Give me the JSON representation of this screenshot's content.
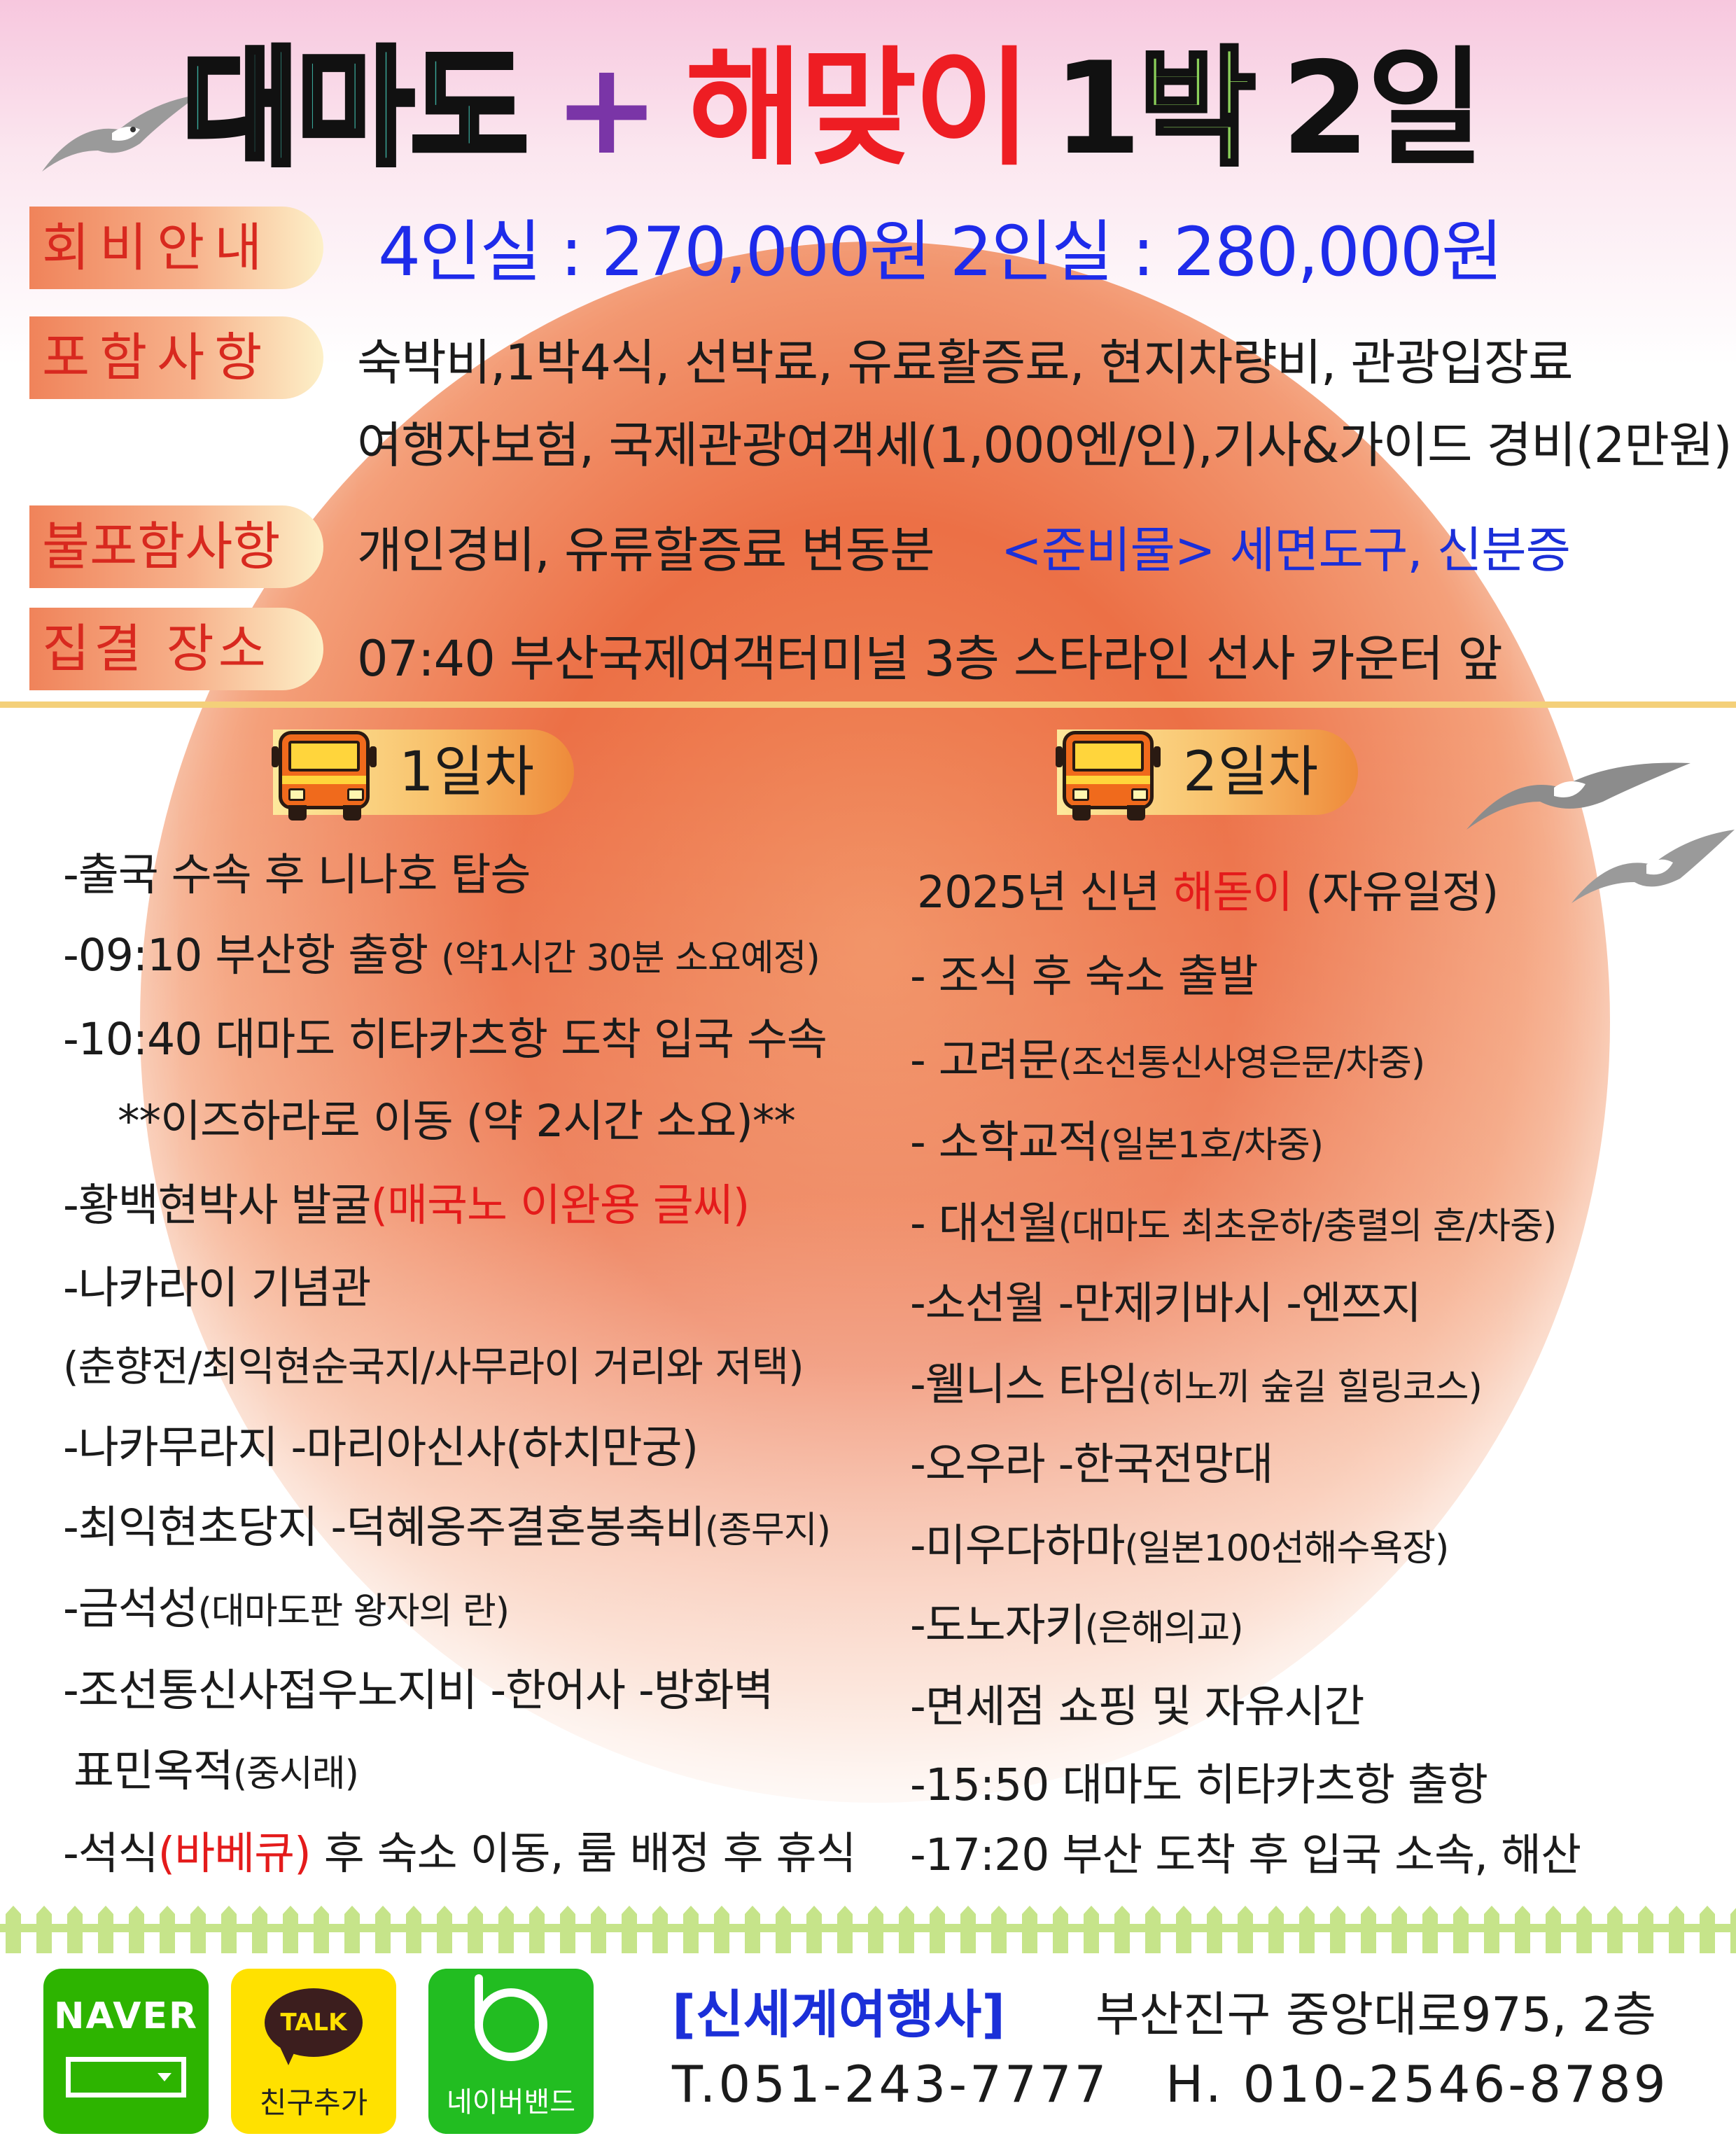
{
  "title": {
    "part1": "대마도",
    "plus": "+",
    "part2": "해맞이",
    "num1": "1",
    "bak": "박",
    "num2": "2일"
  },
  "info": {
    "fee_label": "회비안내",
    "fee_text": "4인실 : 270,000원   2인실 : 280,000원",
    "include_label": "포함사항",
    "include_line1": "숙박비,1박4식, 선박료, 유료활증료, 현지차량비, 관광입장료",
    "include_line2": "여행자보험, 국제관광여객세(1,000엔/인),기사&가이드 경비(2만원)",
    "exclude_label": "불포함사항",
    "exclude_text": "개인경비, 유류할증료 변동분",
    "prepare_text": "<준비물> 세면도구, 신분증",
    "meet_label": "집결 장소",
    "meet_text": "07:40 부산국제여객터미널 3층 스타라인 선사 카운터 앞"
  },
  "day1": {
    "label": "1일차",
    "items": [
      {
        "main": "-출국 수속 후 니나호 탑승",
        "note": ""
      },
      {
        "main": "-09:10 부산항 출항 ",
        "note": "(약1시간 30분 소요예정)"
      },
      {
        "main": "-10:40 대마도 히타카츠항 도착 입국 수속",
        "note": ""
      },
      {
        "main": "**이즈하라로 이동 (약 2시간 소요)**",
        "note": ""
      },
      {
        "main": "-황백현박사 발굴",
        "red": "(매국노 이완용 글씨)"
      },
      {
        "main": "-나카라이 기념관",
        "note": ""
      },
      {
        "main": "(춘향전/최익현순국지/사무라이 거리와 저택)",
        "note": ""
      },
      {
        "main": "-나카무라지  -마리아신사(하치만궁)",
        "note": ""
      },
      {
        "main": "-최익현초당지  -덕혜옹주결혼봉축비",
        "note": "(종무지)"
      },
      {
        "main": "-금석성",
        "note": "(대마도판 왕자의 란)"
      },
      {
        "main": "-조선통신사접우노지비  -한어사  -방화벽",
        "note": ""
      },
      {
        "main": "표민옥적",
        "note": "(중시래)"
      },
      {
        "main": "-석식",
        "red": "(바베큐)",
        "after": " 후 숙소 이동, 룸 배정 후 휴식"
      }
    ]
  },
  "day2": {
    "label": "2일차",
    "items": [
      {
        "main": "2025년 신년 ",
        "red": "해돋이",
        "after": " (자유일정)"
      },
      {
        "main": "-  조식 후 숙소 출발",
        "note": ""
      },
      {
        "main": "-  고려문",
        "note": "(조선통신사영은문/차중)"
      },
      {
        "main": "-  소학교적",
        "note": "(일본1호/차중)"
      },
      {
        "main": "-  대선월",
        "note": "(대마도 최초운하/충렬의 혼/차중)"
      },
      {
        "main": "-소선월    -만제키바시    -엔쯔지",
        "note": ""
      },
      {
        "main": "-웰니스 타임",
        "note": "(히노끼 숲길 힐링코스)"
      },
      {
        "main": "-오우라    -한국전망대",
        "note": ""
      },
      {
        "main": "-미우다하마",
        "note": "(일본100선해수욕장)"
      },
      {
        "main": "-도노자키",
        "note": "(은해의교)"
      },
      {
        "main": "-면세점 쇼핑 및 자유시간",
        "note": ""
      },
      {
        "main": "-15:50 대마도 히타카츠항 출항",
        "note": ""
      },
      {
        "main": "-17:20 부산 도착 후 입국 소속, 해산",
        "note": ""
      }
    ]
  },
  "footer": {
    "naver": "NAVER",
    "kakao_talk": "TALK",
    "kakao_label": "친구추가",
    "band_label": "네이버밴드",
    "company": "[신세계여행사]",
    "address": "부산진구 중앙대로975, 2층",
    "tel": "T.051-243-7777",
    "mobile": "H. 010-2546-8789"
  },
  "colors": {
    "title_teal": "#3aa89a",
    "title_red": "#ee1d23",
    "title_purple": "#7a35a7",
    "title_green": "#8bd05a",
    "price_blue": "#1e2bea",
    "label_red": "#d8291f",
    "sun": "#ec7046"
  }
}
